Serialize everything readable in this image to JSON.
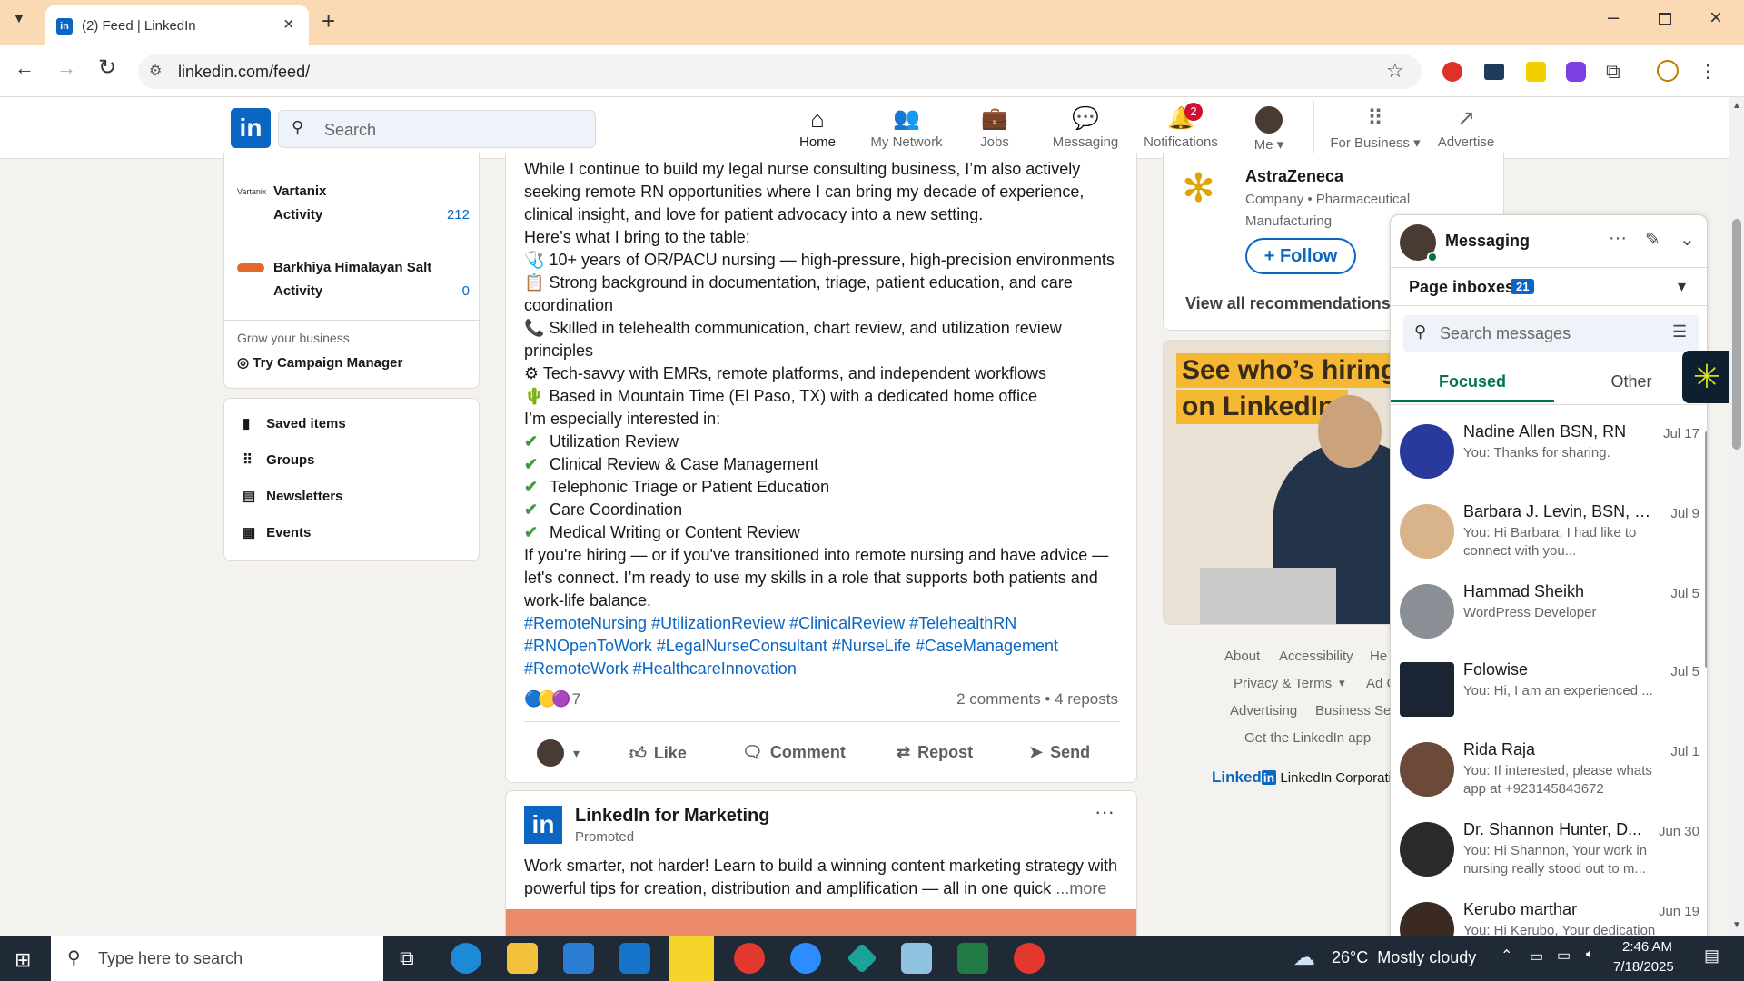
{
  "browser": {
    "tab_title": "(2) Feed | LinkedIn",
    "url": "linkedin.com/feed/"
  },
  "nav": {
    "search_placeholder": "Search",
    "items": [
      {
        "label": "Home"
      },
      {
        "label": "My Network"
      },
      {
        "label": "Jobs"
      },
      {
        "label": "Messaging"
      },
      {
        "label": "Notifications",
        "badge": "2"
      },
      {
        "label": "Me"
      },
      {
        "label": "For Business"
      },
      {
        "label": "Advertise"
      }
    ]
  },
  "left": {
    "pages": [
      {
        "name": "Vartanix",
        "activity_label": "Activity",
        "count": "212"
      },
      {
        "name": "Barkhiya Himalayan Salt",
        "activity_label": "Activity",
        "count": "0"
      }
    ],
    "grow": "Grow your business",
    "campaign": "Try Campaign Manager",
    "links": [
      "Saved items",
      "Groups",
      "Newsletters",
      "Events"
    ]
  },
  "post": {
    "intro": "While I continue to build my legal nurse consulting business, I’m also actively seeking remote RN opportunities where I can bring my decade of experience, clinical insight, and love for patient advocacy into a new setting.",
    "table_intro": "Here’s what I bring to the table:",
    "bullets": [
      {
        "icon": "🩺",
        "text": "10+ years of OR/PACU nursing — high-pressure, high-precision environments"
      },
      {
        "icon": "📋",
        "text": "Strong background in documentation, triage, patient education, and care coordination"
      },
      {
        "icon": "📞",
        "text": "Skilled in telehealth communication, chart review, and utilization review principles"
      },
      {
        "icon": "⚙",
        "text": "Tech-savvy with EMRs, remote platforms, and independent workflows"
      },
      {
        "icon": "🌵",
        "text": "Based in Mountain Time (El Paso, TX) with a dedicated home office"
      }
    ],
    "interested": "I’m especially interested in:",
    "checks": [
      "Utilization Review",
      "Clinical Review & Case Management",
      "Telephonic Triage or Patient Education",
      "Care Coordination",
      "Medical Writing or Content Review"
    ],
    "outro": "If you're hiring — or if you've transitioned into remote nursing and have advice — let's connect. I’m ready to use my skills in a role that supports both patients and work-life balance.",
    "hashtags_1": "#RemoteNursing #UtilizationReview #ClinicalReview #TelehealthRN",
    "hashtags_2": "#RNOpenToWork #LegalNurseConsultant #NurseLife #CaseManagement",
    "hashtags_3": "#RemoteWork #HealthcareInnovation",
    "reactions": "7",
    "stats": "2 comments • 4 reposts",
    "actions": [
      "Like",
      "Comment",
      "Repost",
      "Send"
    ]
  },
  "promo": {
    "name": "LinkedIn for Marketing",
    "sub": "Promoted",
    "text": "Work smarter, not harder! Learn to build a winning content marketing strategy with powerful tips for creation, distribution and amplification — all in one quick",
    "more": "...more"
  },
  "right": {
    "company": "AstraZeneca",
    "company_sub": "Company • Pharmaceutical Manufacturing",
    "follow": "Follow",
    "view_all": "View all recommendations",
    "ad_line1": "See who’s hiring",
    "ad_line2": "on LinkedIn.",
    "footer": [
      "About",
      "Accessibility",
      "He",
      "Privacy & Terms",
      "Ad C",
      "Advertising",
      "Business Ser",
      "Get the LinkedIn app"
    ],
    "corp": "LinkedIn Corporati",
    "linkedin_word": "Linked"
  },
  "messaging": {
    "title": "Messaging",
    "inboxes": "Page inboxes",
    "inbox_count": "21",
    "search_placeholder": "Search messages",
    "tab_focused": "Focused",
    "tab_other": "Other",
    "rows": [
      {
        "name": "Nadine Allen BSN, RN",
        "date": "Jul 17",
        "preview": "You: Thanks for sharing.",
        "color": "#2a3a9c"
      },
      {
        "name": "Barbara J. Levin, BSN, RN...",
        "date": "Jul 9",
        "preview": "You: Hi Barbara, I had like to connect with you...",
        "color": "#d9b48a"
      },
      {
        "name": "Hammad Sheikh",
        "date": "Jul 5",
        "preview": "WordPress Developer",
        "color": "#8a8f96"
      },
      {
        "name": "Folowise",
        "date": "Jul 5",
        "preview": "You: Hi, I am an experienced ...",
        "color": "#1b2433"
      },
      {
        "name": "Rida Raja",
        "date": "Jul 1",
        "preview": "You: If interested, please whats app at +923145843672",
        "color": "#6b4a3a"
      },
      {
        "name": "Dr. Shannon Hunter, D...",
        "date": "Jun 30",
        "preview": "You: Hi Shannon, Your work in nursing really stood out to m...",
        "color": "#2a2a2a"
      },
      {
        "name": "Kerubo marthar",
        "date": "Jun 19",
        "preview": "You: Hi Kerubo, Your dedication",
        "color": "#3b2a22"
      }
    ]
  },
  "taskbar": {
    "search_placeholder": "Type here to search",
    "weather": "26°C  Mostly cloudy",
    "time": "2:46 AM",
    "date": "7/18/2025"
  }
}
